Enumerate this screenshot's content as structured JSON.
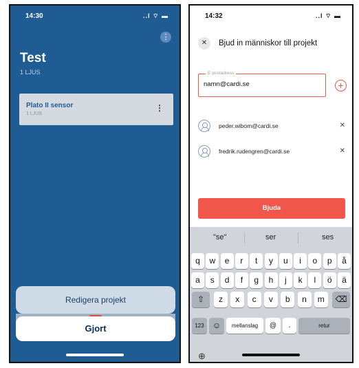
{
  "left": {
    "status_time": "14:30",
    "status_icons": "..l ⌔ ▬",
    "project_title": "Test",
    "project_subtitle": "1 LJUS",
    "card": {
      "name": "Plato II sensor",
      "sub": "1 LJUS"
    },
    "sheet": {
      "edit_label": "Redigera projekt",
      "done_label": "Gjort"
    }
  },
  "right": {
    "status_time": "14:32",
    "status_icons": "..l ⌔ ▬",
    "title": "Bjud in människor till projekt",
    "email_label": "E-postadress",
    "email_value": "namn@cardi.se",
    "people": [
      {
        "email": "peder.wibom@cardi.se"
      },
      {
        "email": "fredrik.rudengren@cardi.se"
      }
    ],
    "invite_label": "Bjuda",
    "keyboard": {
      "suggestions": [
        "\"se\"",
        "ser",
        "ses"
      ],
      "row1": [
        "q",
        "w",
        "e",
        "r",
        "t",
        "y",
        "u",
        "i",
        "o",
        "p",
        "å"
      ],
      "row2": [
        "a",
        "s",
        "d",
        "f",
        "g",
        "h",
        "j",
        "k",
        "l",
        "ö",
        "ä"
      ],
      "row3": [
        "z",
        "x",
        "c",
        "v",
        "b",
        "n",
        "m"
      ],
      "num_label": "123",
      "space_label": "mellanslag",
      "at_label": "@",
      "dot_label": ".",
      "return_label": "retur"
    }
  }
}
